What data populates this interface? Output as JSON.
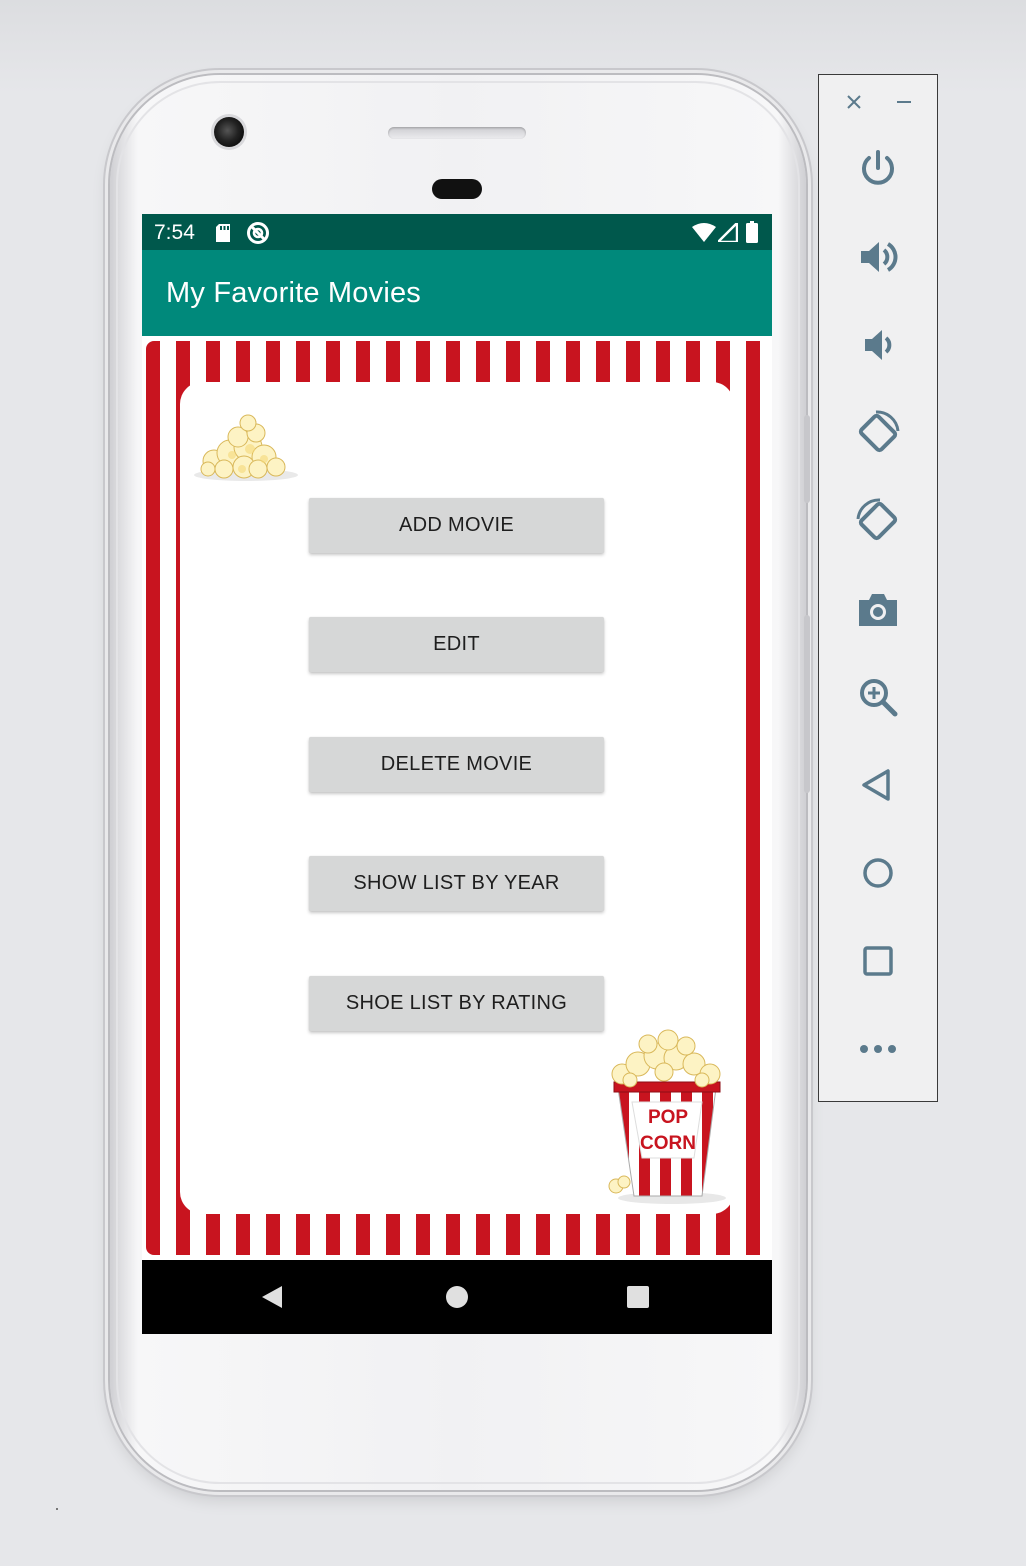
{
  "app": {
    "title": "My Favorite Movies"
  },
  "status_bar": {
    "time": "7:54",
    "icons": [
      "sd-card-icon",
      "sync-icon",
      "wifi-icon",
      "cell-signal-icon",
      "battery-icon"
    ]
  },
  "menu_buttons": [
    {
      "label": "ADD MOVIE"
    },
    {
      "label": "EDIT"
    },
    {
      "label": "DELETE MOVIE"
    },
    {
      "label": "SHOW LIST BY YEAR"
    },
    {
      "label": "SHOE LIST BY RATING"
    }
  ],
  "popcorn_box": {
    "line1": "POP",
    "line2": "CORN"
  },
  "nav_bar": {
    "buttons": [
      "back-icon",
      "home-icon",
      "recents-icon"
    ]
  },
  "emulator_toolbar": {
    "items": [
      "close-icon",
      "minimize-icon",
      "power-icon",
      "volume-up-icon",
      "volume-down-icon",
      "rotate-left-icon",
      "rotate-right-icon",
      "camera-icon",
      "zoom-icon",
      "back-icon",
      "home-icon",
      "overview-icon",
      "more-icon"
    ]
  },
  "colors": {
    "status_bar": "#00584c",
    "app_bar": "#00897b",
    "stripe_red": "#c8141f",
    "button_bg": "#d6d7d7",
    "toolbar_icon": "#5b7a8c"
  }
}
